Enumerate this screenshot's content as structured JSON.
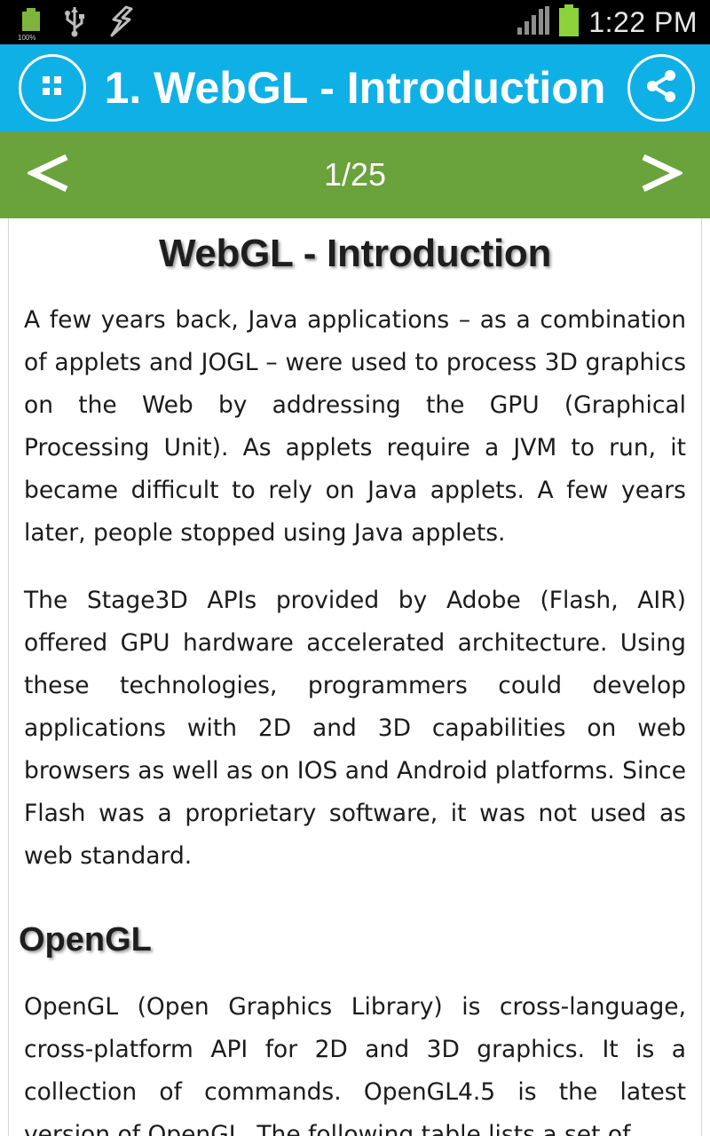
{
  "status_bar": {
    "time": "1:22 PM",
    "battery_small_label": "100%",
    "icons": [
      "battery-full-small-icon",
      "usb-icon",
      "debug-icon",
      "signal-icon",
      "battery-icon"
    ]
  },
  "app_bar": {
    "title": "1. WebGL - Introduction",
    "menu_icon": "grid-menu-icon",
    "share_icon": "share-icon",
    "color": "#0fb0e6"
  },
  "pager": {
    "prev_label": "<",
    "next_label": ">",
    "page_indicator": "1/25",
    "color": "#6aa23b"
  },
  "article": {
    "title": "WebGL - Introduction",
    "paragraphs": [
      "A few years back, Java applications – as a combination of applets and JOGL – were used to process 3D graphics on the Web by addressing the GPU (Graphical Processing Unit). As applets require a JVM to run, it became difficult to rely on Java applets. A few years later, people stopped using Java applets.",
      "The Stage3D APIs provided by Adobe (Flash, AIR) offered GPU hardware accelerated architecture. Using these technologies, programmers could develop applications with 2D and 3D capabilities on web browsers as well as on IOS and Android platforms. Since Flash was a proprietary software, it was not used as web standard."
    ],
    "section_heading": "OpenGL",
    "section_paragraph": "OpenGL (Open Graphics Library) is cross-language, cross-platform API for 2D and 3D graphics. It is a collection of commands. OpenGL4.5 is the latest version of OpenGL. The following table lists a set of"
  }
}
